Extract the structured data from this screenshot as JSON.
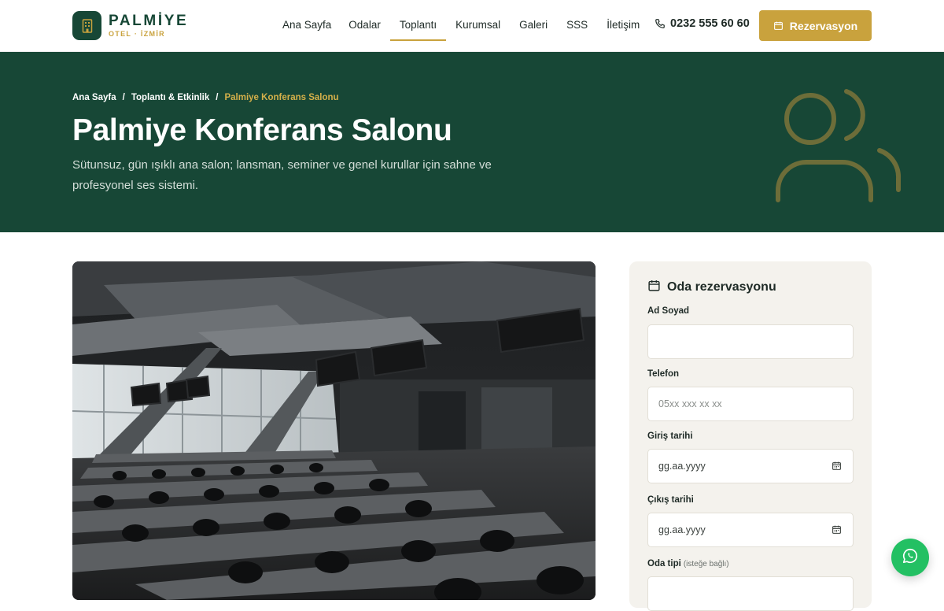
{
  "brand": {
    "name": "PALMİYE",
    "tagline": "OTEL · İZMİR"
  },
  "nav": [
    {
      "label": "Ana Sayfa"
    },
    {
      "label": "Odalar"
    },
    {
      "label": "Toplantı",
      "active": true
    },
    {
      "label": "Kurumsal"
    },
    {
      "label": "Galeri"
    },
    {
      "label": "SSS"
    },
    {
      "label": "İletişim"
    }
  ],
  "phone": "0232 555 60 60",
  "cta_label": "Rezervasyon",
  "breadcrumb": [
    "Ana Sayfa",
    "Toplantı & Etkinlik",
    "Palmiye Konferans Salonu"
  ],
  "hero": {
    "title": "Palmiye Konferans Salonu",
    "description": "Sütunsuz, gün ışıklı ana salon; lansman, seminer ve genel kurullar için sahne ve profesyonel ses sistemi."
  },
  "form": {
    "title": "Oda rezervasyonu",
    "name_label": "Ad Soyad",
    "name_value": "",
    "phone_label": "Telefon",
    "phone_placeholder": "05xx xxx xx xx",
    "checkin_label": "Giriş tarihi",
    "checkin_placeholder": "gg.aa.yyyy",
    "checkout_label": "Çıkış tarihi",
    "checkout_placeholder": "gg.aa.yyyy",
    "roomtype_label": "Oda tipi",
    "roomtype_optional": "(isteğe bağlı)"
  },
  "colors": {
    "brand_green": "#174736",
    "accent_gold": "#c9a23d",
    "whatsapp": "#23c063"
  },
  "icons": [
    "building-icon",
    "phone-icon",
    "calendar-icon",
    "users-icon",
    "whatsapp-icon"
  ]
}
